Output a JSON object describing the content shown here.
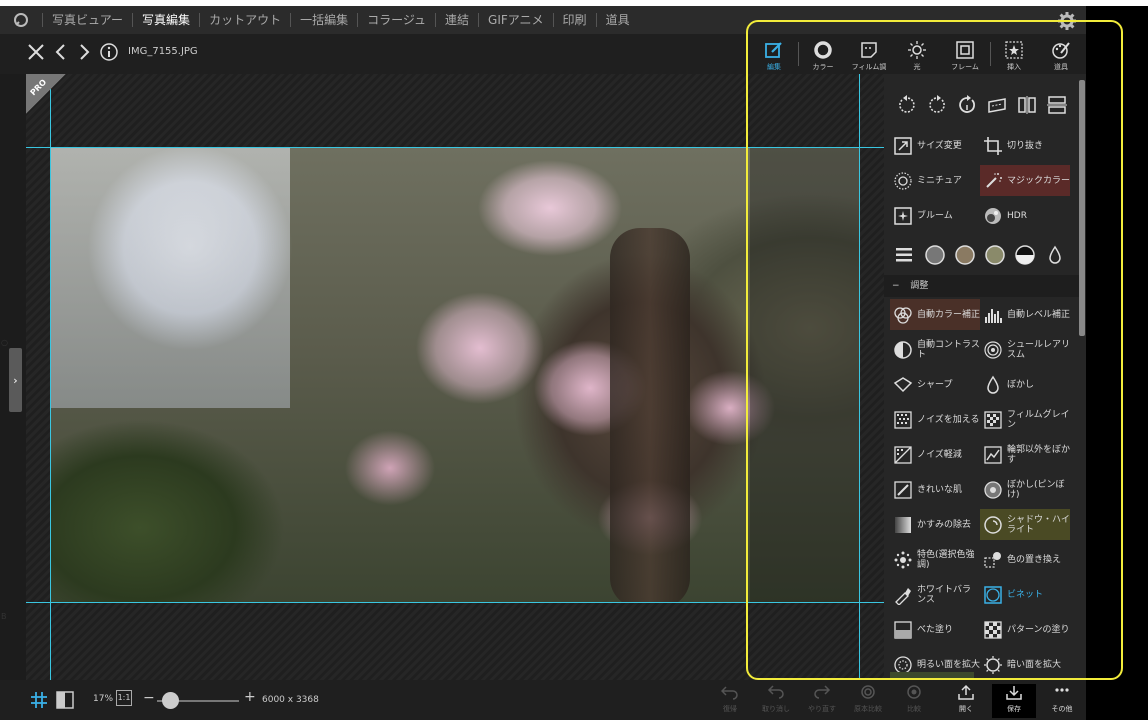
{
  "menu": {
    "items": [
      "写真ビュアー",
      "写真編集",
      "カットアウト",
      "一括編集",
      "コラージュ",
      "連結",
      "GIFアニメ",
      "印刷",
      "道具"
    ],
    "active_index": 1
  },
  "file": {
    "name": "IMG_7155.JPG"
  },
  "badge": {
    "pro": "PRO"
  },
  "tool_tabs": [
    {
      "label": "編集",
      "icon": "edit-icon"
    },
    {
      "label": "カラー",
      "icon": "color-icon"
    },
    {
      "label": "フィルム調",
      "icon": "film-icon"
    },
    {
      "label": "光",
      "icon": "light-icon"
    },
    {
      "label": "フレーム",
      "icon": "frame-icon"
    },
    {
      "label": "挿入",
      "icon": "insert-icon"
    },
    {
      "label": "道具",
      "icon": "tools-icon"
    }
  ],
  "tools_top": [
    {
      "label": "サイズ変更",
      "icon": "resize-icon"
    },
    {
      "label": "切り抜き",
      "icon": "crop-icon"
    },
    {
      "label": "ミニチュア",
      "icon": "miniature-icon"
    },
    {
      "label": "マジックカラー",
      "icon": "magic-color-icon"
    },
    {
      "label": "ブルーム",
      "icon": "bloom-icon"
    },
    {
      "label": "HDR",
      "icon": "hdr-icon"
    }
  ],
  "section": {
    "title": "調整",
    "toggle": "−"
  },
  "tools_adjust": [
    {
      "label": "自動カラー補正",
      "icon": "auto-color-icon"
    },
    {
      "label": "自動レベル補正",
      "icon": "auto-level-icon"
    },
    {
      "label": "自動コントラスト",
      "icon": "auto-contrast-icon"
    },
    {
      "label": "シュールレアリスム",
      "icon": "surreal-icon"
    },
    {
      "label": "シャープ",
      "icon": "sharpen-icon"
    },
    {
      "label": "ぼかし",
      "icon": "blur-icon"
    },
    {
      "label": "ノイズを加える",
      "icon": "add-noise-icon"
    },
    {
      "label": "フィルムグレイン",
      "icon": "film-grain-icon"
    },
    {
      "label": "ノイズ軽減",
      "icon": "denoise-icon"
    },
    {
      "label": "輪郭以外をぼかす",
      "icon": "blur-except-edges-icon"
    },
    {
      "label": "きれいな肌",
      "icon": "beauty-skin-icon"
    },
    {
      "label": "ぼかし(ピンぼけ)",
      "icon": "defocus-icon"
    },
    {
      "label": "かすみの除去",
      "icon": "dehaze-icon"
    },
    {
      "label": "シャドウ・ハイライト",
      "icon": "shadow-highlight-icon"
    },
    {
      "label": "特色(選択色強調)",
      "icon": "color-splash-icon"
    },
    {
      "label": "色の置き換え",
      "icon": "color-replace-icon"
    },
    {
      "label": "ホワイトバランス",
      "icon": "white-balance-icon"
    },
    {
      "label": "ビネット",
      "icon": "vignette-icon"
    },
    {
      "label": "べた塗り",
      "icon": "fill-icon"
    },
    {
      "label": "パターンの塗り",
      "icon": "pattern-fill-icon"
    },
    {
      "label": "明るい面を拡大",
      "icon": "expand-light-icon"
    },
    {
      "label": "暗い面を拡大",
      "icon": "expand-dark-icon"
    }
  ],
  "zoom": {
    "percent": "17%",
    "one_to_one": "1:1",
    "minus": "−",
    "plus": "+",
    "level": 0.1
  },
  "image_size": "6000 x 3368",
  "bottom_actions": [
    {
      "label": "復帰",
      "enabled": false
    },
    {
      "label": "取り消し",
      "enabled": false
    },
    {
      "label": "やり直す",
      "enabled": false
    },
    {
      "label": "原本比較",
      "enabled": false
    },
    {
      "label": "比較",
      "enabled": false
    },
    {
      "label": "開く",
      "enabled": true
    },
    {
      "label": "保存",
      "enabled": true
    },
    {
      "label": "その他",
      "enabled": true
    }
  ],
  "left_edge": {
    "mark1": "○",
    "mark2": "B"
  },
  "colors": {
    "accent": "#3ab0e6",
    "guide": "#3ac6e0",
    "highlight": "#f2ec3b"
  }
}
